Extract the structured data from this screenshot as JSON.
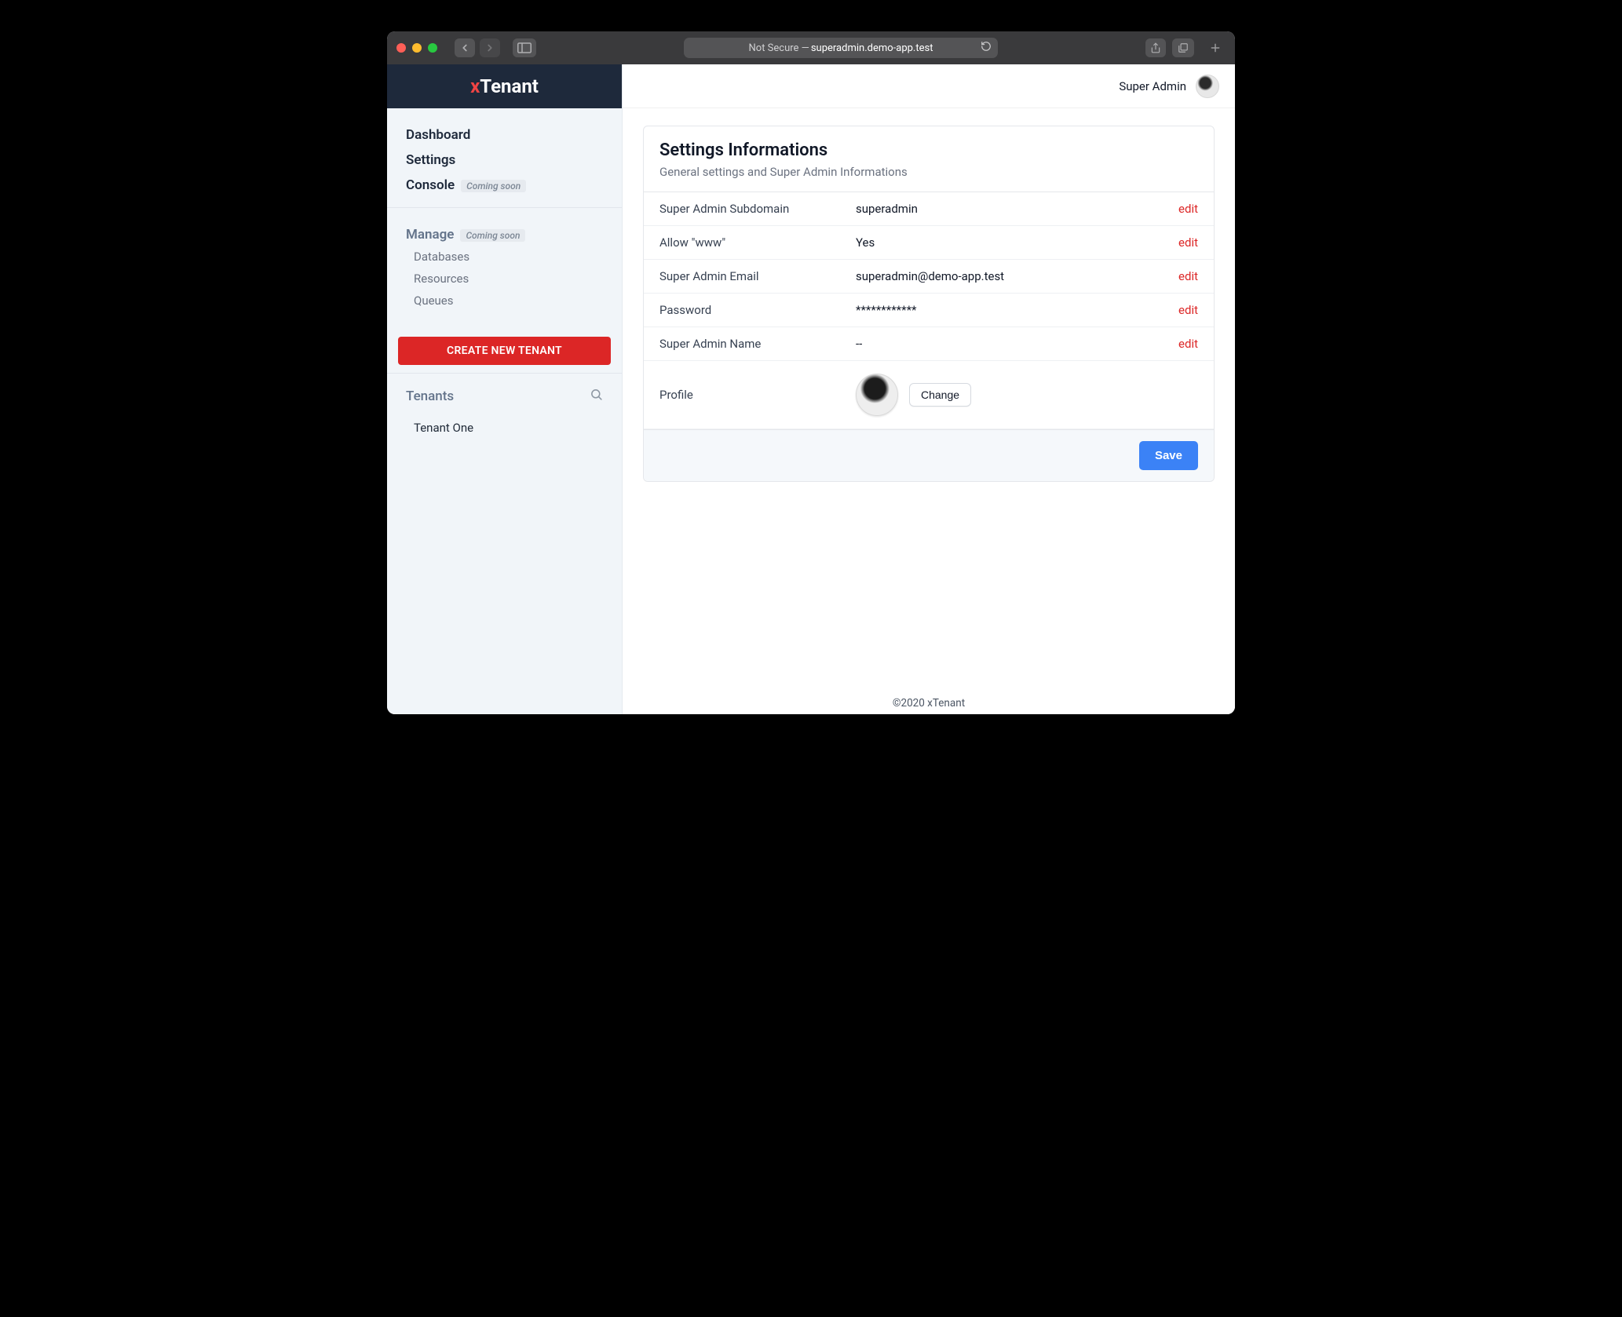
{
  "chrome": {
    "address_prefix": "Not Secure — ",
    "address_host": "superadmin.demo-app.test"
  },
  "brand": {
    "x": "x",
    "name": "Tenant"
  },
  "sidebar": {
    "nav": {
      "dashboard": "Dashboard",
      "settings": "Settings",
      "console": "Console",
      "coming_soon": "Coming soon"
    },
    "manage": {
      "heading": "Manage",
      "coming_soon": "Coming soon",
      "items": [
        "Databases",
        "Resources",
        "Queues"
      ]
    },
    "create_button": "CREATE NEW TENANT",
    "tenants": {
      "heading": "Tenants",
      "items": [
        "Tenant One"
      ]
    }
  },
  "topbar": {
    "username": "Super Admin"
  },
  "settings_card": {
    "title": "Settings Informations",
    "subtitle": "General settings and Super Admin Informations",
    "edit_label": "edit",
    "rows": {
      "subdomain": {
        "label": "Super Admin Subdomain",
        "value": "superadmin"
      },
      "allow_www": {
        "label": "Allow \"www\"",
        "value": "Yes"
      },
      "email": {
        "label": "Super Admin Email",
        "value": "superadmin@demo-app.test"
      },
      "password": {
        "label": "Password",
        "value": "************"
      },
      "name": {
        "label": "Super Admin Name",
        "value": "--"
      },
      "profile": {
        "label": "Profile",
        "change_label": "Change"
      }
    },
    "save_label": "Save"
  },
  "footer": "©2020 xTenant"
}
